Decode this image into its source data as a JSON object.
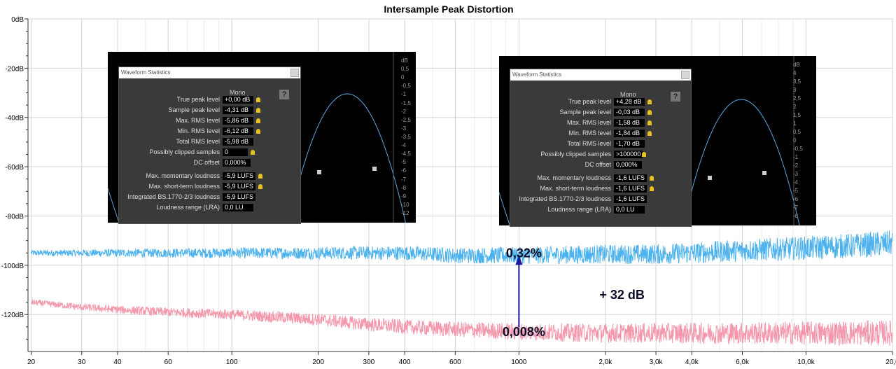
{
  "chart_data": {
    "type": "line",
    "title": "Intersample Peak Distortion",
    "x_scale": "log",
    "xlim": [
      19.5,
      20000
    ],
    "ylim": [
      -135,
      0
    ],
    "x_ticks": [
      20,
      30,
      40,
      60,
      100,
      200,
      300,
      400,
      600,
      1000,
      2000,
      3000,
      4000,
      6000,
      10000,
      20000
    ],
    "x_tick_labels": [
      "20",
      "30",
      "40",
      "60",
      "100",
      "200",
      "300",
      "400",
      "600",
      "1000",
      "2,0k",
      "3,0k",
      "4,0k",
      "6,0k",
      "10,0k",
      "20,0"
    ],
    "y_ticks": [
      0,
      -20,
      -40,
      -60,
      -80,
      -100,
      -120
    ],
    "y_tick_labels": [
      "0dB",
      "-20dB",
      "-40dB",
      "-60dB",
      "-80dB",
      "-100dB",
      "-120dB"
    ],
    "grid": true,
    "series": [
      {
        "color": "#4cb2ee",
        "x": [
          20,
          30,
          40,
          60,
          100,
          200,
          300,
          400,
          600,
          1000,
          2000,
          3000,
          4000,
          6000,
          10000,
          15000,
          20000
        ],
        "y": [
          -95,
          -95,
          -95,
          -95,
          -95,
          -95,
          -95,
          -95,
          -96,
          -96,
          -95.5,
          -95.5,
          -95,
          -94,
          -93,
          -92,
          -91
        ]
      },
      {
        "color": "#f497ab",
        "x": [
          20,
          30,
          40,
          60,
          100,
          200,
          300,
          400,
          600,
          1000,
          2000,
          3000,
          4000,
          6000,
          10000,
          15000,
          20000
        ],
        "y": [
          -115,
          -117,
          -118,
          -119,
          -120,
          -122,
          -124,
          -125,
          -126,
          -127,
          -127.5,
          -127.5,
          -127.5,
          -127.5,
          -127.5,
          -127.5,
          -127.5
        ]
      }
    ],
    "annotations": [
      {
        "text": "0,32%",
        "x": 1000,
        "y": -95
      },
      {
        "text": "+ 32 dB",
        "x": 1500,
        "y": -112
      },
      {
        "text": "0,008%",
        "x": 1000,
        "y": -127
      }
    ],
    "arrow": {
      "x": 1000,
      "y_from": -125,
      "y_to": -97,
      "color": "#1a1aa0"
    }
  },
  "panels": [
    {
      "window_title": "Waveform Statistics",
      "channel": "Mono",
      "help": "?",
      "rows": [
        {
          "label": "True peak level",
          "value": "+0,00 dB",
          "pin": true
        },
        {
          "label": "Sample peak level",
          "value": "-4,31 dB",
          "pin": true
        },
        {
          "label": "Max. RMS level",
          "value": "-5,86 dB",
          "pin": true
        },
        {
          "label": "Min. RMS level",
          "value": "-6,12 dB",
          "pin": true
        },
        {
          "label": "Total RMS level",
          "value": "-5,98 dB",
          "pin": false
        },
        {
          "label": "Possibly clipped samples",
          "value": "0",
          "pin": true
        },
        {
          "label": "DC offset",
          "value": "0,000%",
          "pin": false
        },
        {
          "label": "Max. momentary loudness",
          "value": "-5,9 LUFS",
          "pin": true
        },
        {
          "label": "Max. short-term loudness",
          "value": "-5,9 LUFS",
          "pin": true
        },
        {
          "label": "Integrated BS.1770-2/3 loudness",
          "value": "-5,9 LUFS",
          "pin": false
        },
        {
          "label": "Loudness range (LRA)",
          "value": "0,0 LU",
          "pin": false
        }
      ],
      "scale": [
        "dB",
        "0,5",
        "0",
        "-0,5",
        "-1",
        "-1,5",
        "-2",
        "-2,5",
        "-3",
        "-3,5",
        "-4",
        "-4,5",
        "-5",
        "-6",
        "-7",
        "-8",
        "-9",
        "-10",
        "-12"
      ]
    },
    {
      "window_title": "Waveform Statistics",
      "channel": "Mono",
      "help": "?",
      "rows": [
        {
          "label": "True peak level",
          "value": "+4,28 dB",
          "pin": true
        },
        {
          "label": "Sample peak level",
          "value": "-0,03 dB",
          "pin": true
        },
        {
          "label": "Max. RMS level",
          "value": "-1,58 dB",
          "pin": true
        },
        {
          "label": "Min. RMS level",
          "value": "-1,84 dB",
          "pin": true
        },
        {
          "label": "Total RMS level",
          "value": "-1,70 dB",
          "pin": false
        },
        {
          "label": "Possibly clipped samples",
          "value": ">100000",
          "pin": true
        },
        {
          "label": "DC offset",
          "value": "0,000%",
          "pin": false
        },
        {
          "label": "Max. momentary loudness",
          "value": "-1,6 LUFS",
          "pin": true
        },
        {
          "label": "Max. short-term loudness",
          "value": "-1,6 LUFS",
          "pin": true
        },
        {
          "label": "Integrated BS.1770-2/3 loudness",
          "value": "-1,6 LUFS",
          "pin": false
        },
        {
          "label": "Loudness range (LRA)",
          "value": "0,0 LU",
          "pin": false
        }
      ],
      "scale": [
        "dB",
        "4",
        "3,5",
        "3",
        "2,5",
        "2",
        "1,5",
        "1",
        "0,5",
        "0",
        "-0,5",
        "-1",
        "-2",
        "-3",
        "-4",
        "-5",
        "-6",
        "-7",
        "-8"
      ]
    }
  ]
}
